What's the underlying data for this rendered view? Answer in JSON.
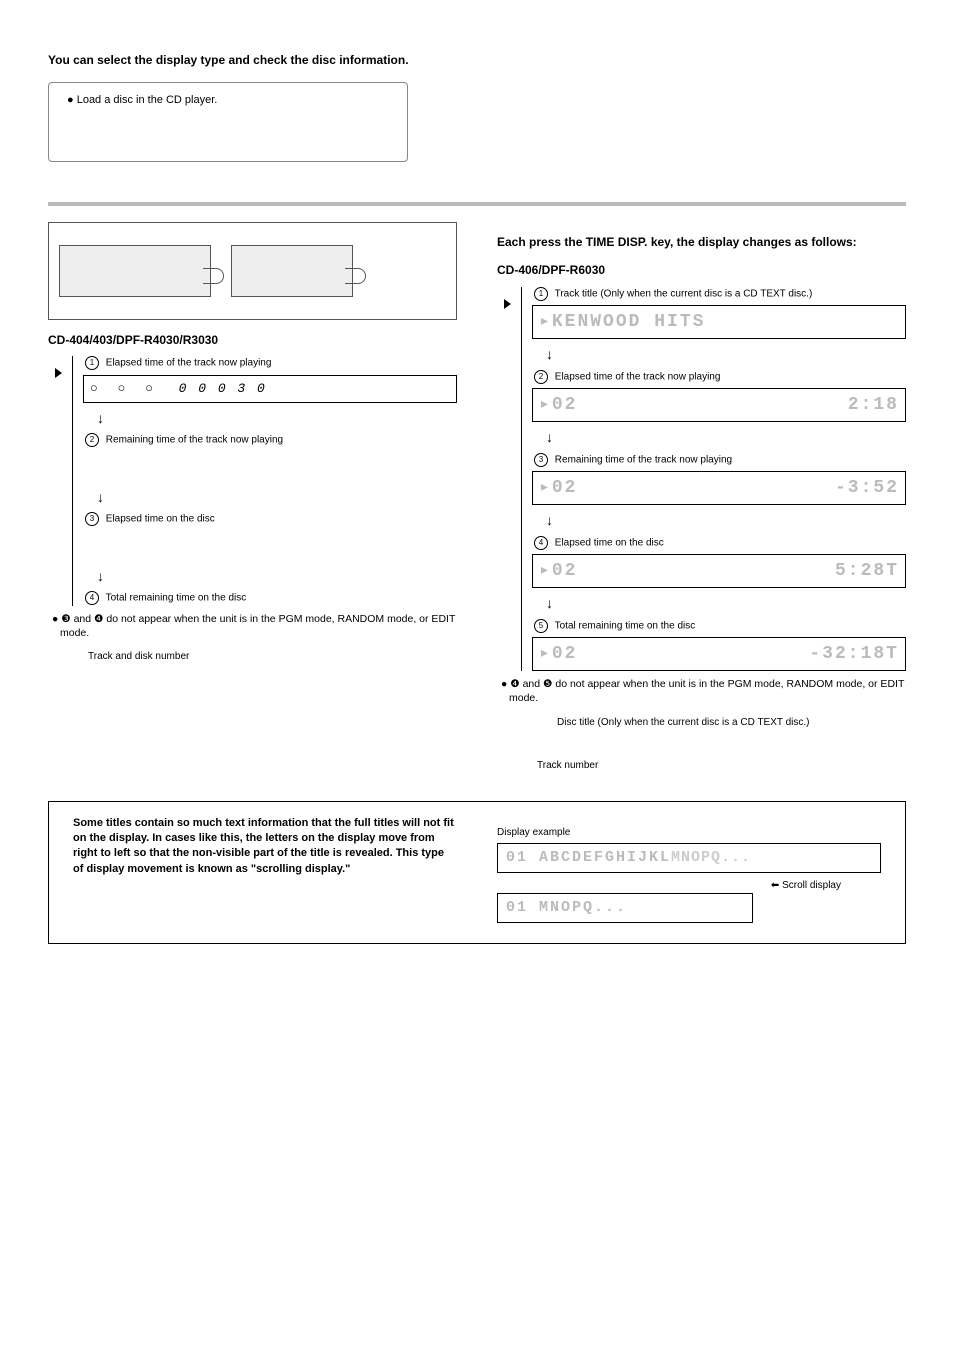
{
  "intro": "You can select the display type and check the disc information.",
  "prep_bullet": "Load a disc in the CD player.",
  "left": {
    "model_heading": "CD-404/403/DPF-R4030/R3030",
    "states": [
      {
        "n": "1",
        "label": "Elapsed time of the track now playing",
        "display": "0 0 0   3 0"
      },
      {
        "n": "2",
        "label": "Remaining time of the track now playing",
        "display": ""
      },
      {
        "n": "3",
        "label": "Elapsed time on the disc",
        "display": ""
      },
      {
        "n": "4",
        "label": "Total remaining time on the disc",
        "display": ""
      }
    ],
    "note": "❸ and ❹ do not appear when the unit is in the PGM mode, RANDOM mode, or EDIT mode.",
    "caption": "Track and disk number"
  },
  "right": {
    "lead": "Each press the TIME DISP. key, the display changes as follows:",
    "model_heading": "CD-406/DPF-R6030",
    "states": [
      {
        "n": "1",
        "label": "Track title (Only when the current disc is a CD TEXT disc.)",
        "left": "▸KENWOOD HITS",
        "right": ""
      },
      {
        "n": "2",
        "label": "Elapsed time of the track now playing",
        "left": "▸02",
        "right": "2:18"
      },
      {
        "n": "3",
        "label": "Remaining time of the track now playing",
        "left": "▸02",
        "right": "-3:52"
      },
      {
        "n": "4",
        "label": "Elapsed time on the disc",
        "left": "▸02",
        "right": "5:28T"
      },
      {
        "n": "5",
        "label": "Total remaining time on the disc",
        "left": "▸02",
        "right": "-32:18T"
      }
    ],
    "note": "❹ and ❺ do not appear when the unit is in the PGM mode, RANDOM mode, or EDIT mode.",
    "caption_disc": "Disc title (Only when the current disc is a CD TEXT disc.)",
    "caption_track": "Track number"
  },
  "scroll": {
    "text": "Some titles contain so much text information that the full titles will not fit on the display.  In cases like this, the letters on the display move from right to left so that the non-visible part of the title is revealed.  This type of display movement is known as \"scrolling display.\"",
    "display_example_label": "Display example",
    "line1_visible": "01  ABCDEFGHIJKL",
    "line1_overflow": "MNOPQ...",
    "arrow_label": "Scroll display",
    "line2": "01  MNOPQ..."
  }
}
